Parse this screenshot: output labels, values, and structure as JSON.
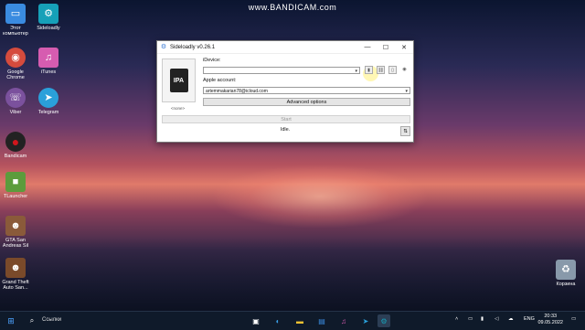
{
  "watermark": "www.BANDICAM.com",
  "desktop_icons": [
    {
      "label": "Этот\nкомпьютер",
      "icon": "computer-icon",
      "color": "#3a8be0"
    },
    {
      "label": "Sideloadly",
      "icon": "gear-icon",
      "color": "#16a0b8"
    },
    {
      "label": "Google\nChrome",
      "icon": "chrome-icon",
      "color": "#d54b3d"
    },
    {
      "label": "iTunes",
      "icon": "music-note-icon",
      "color": "#d65cb0"
    },
    {
      "label": "Viber",
      "icon": "phone-icon",
      "color": "#7b519d"
    },
    {
      "label": "Telegram",
      "icon": "paper-plane-icon",
      "color": "#2aa0da"
    },
    {
      "label": "Bandicam",
      "icon": "record-icon",
      "color": "#d0161c"
    },
    {
      "label": "TLauncher",
      "icon": "block-icon",
      "color": "#5c9c3c"
    },
    {
      "label": "GTA San\nAndreas Sil",
      "icon": "game-icon",
      "color": "#8a5a3a"
    },
    {
      "label": "Grand Theft\nAuto San...",
      "icon": "game-icon",
      "color": "#7a4a2a"
    },
    {
      "label": "Корзина",
      "icon": "recycle-bin-icon",
      "color": "#8899aa"
    }
  ],
  "window": {
    "title": "Sideloadly v0.26.1",
    "ipa_label": "IPA",
    "ipa_hint": "<none>",
    "device_label": "iDevice:",
    "device_value": "",
    "apple_account_label": "Apple account:",
    "apple_account_value": "artemmakarian78@icloud.com",
    "advanced_options": "Advanced options",
    "start": "Start",
    "status": "Idle."
  },
  "taskbar": {
    "search_placeholder": "Ссылки",
    "language": "ENG",
    "time": "20:33",
    "date": "09.05.2022"
  }
}
